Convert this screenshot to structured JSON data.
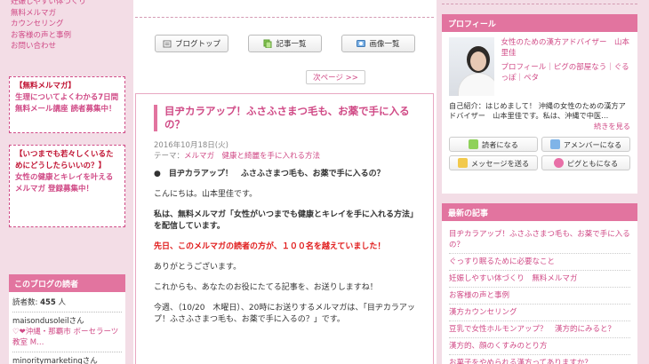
{
  "left": {
    "nav": [
      "妊娠しやすい体づくり",
      "無料メルマガ",
      "カウンセリング",
      "お客様の声と事例",
      "お問い合わせ"
    ],
    "box1": {
      "title": "【無料メルマガ】",
      "text": "生理についてよくわかる7日間無料メール講座 読者募集中！"
    },
    "box2": {
      "title": "【いつまでも若々しくいるためにどうしたらいいの？】",
      "text": "女性の健康とキレイを叶えるメルマガ 登録募集中！"
    },
    "readers": {
      "heading": "このブログの読者",
      "count_label": "読者数:",
      "count": "455",
      "count_unit": "人",
      "reader1": "maisondusoleilさん",
      "reader1_desc": "♡❤沖縄・那覇市 ボーセラーツ教室 M…",
      "reader2": "minoritymarketingさん"
    }
  },
  "toolbar": {
    "top": "ブログトップ",
    "articles": "記事一覧",
    "images": "画像一覧"
  },
  "next_page": "次ページ >>",
  "article": {
    "title": "目ヂカラアップ！ふさふさまつ毛も、お薬で手に入るの？",
    "date": "2016年10月18日(火)",
    "theme_label": "テーマ：",
    "theme": "メルマガ",
    "theme_sub": "健康と綺麗を手に入れる方法",
    "p1": "●　目ヂカラアップ！　ふさふさまつ毛も、お薬で手に入るの？",
    "p2": "こんにちは。山本里佳です。",
    "p3": "私は、無料メルマガ「女性がいつまでも健康とキレイを手に入れる方法」を配信しています。",
    "p4": "先日、このメルマガの読者の方が、１００名を越えていました！",
    "p5": "ありがとうございます。",
    "p6": "これからも、あなたのお役にたてる記事を、お送りしますね！",
    "p7": "今週、（10/20　木曜日）、20時にお送りするメルマガは、「目ヂカラアップ！ふさふさまつ毛も、お薬で手に入るの？」です。"
  },
  "profile": {
    "heading": "プロフィール",
    "name": "女性のための漢方アドバイザー　山本里佳",
    "links": "プロフィール｜ピグの部屋なう｜ぐるっぽ｜ペタ",
    "intro": "自己紹介：はじめまして！ 沖縄の女性のための漢方アドバイザー　山本里佳です。私は、沖縄で中医…",
    "more": "続きを見る",
    "btn_reader": "読者になる",
    "btn_amember": "アメンバーになる",
    "btn_message": "メッセージを送る",
    "btn_pig": "ピグともになる"
  },
  "recent": {
    "heading": "最新の記事",
    "items": [
      "目ヂカラアップ！ふさふさまつ毛も、お薬で手に入るの？",
      "ぐっすり眠るために必要なこと",
      "妊娠しやすい体づくり　無料メルマガ",
      "お客様の声と事例",
      "漢方カウンセリング",
      "豆乳で女性ホルモンアップ？　漢方的にみると？",
      "漢方的、顔のくすみのとり方",
      "お菓子をやめられる漢方ってありますか？"
    ]
  }
}
